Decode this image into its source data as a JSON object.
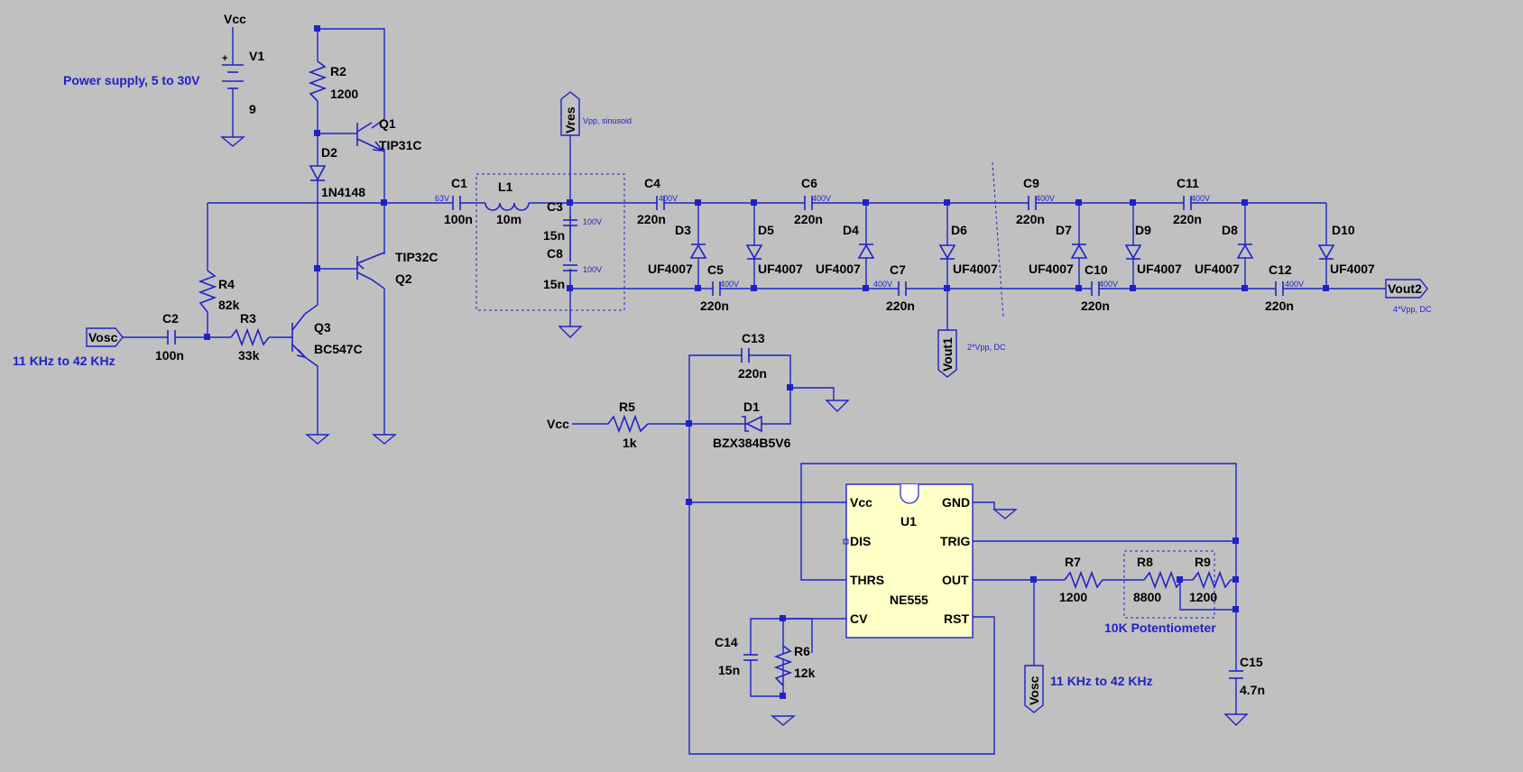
{
  "colors": {
    "background": "#c0c0c0",
    "wire": "#1e22c8",
    "chip": "#ffffc8"
  },
  "labels": {
    "vcc_top": "Vcc",
    "v1": "V1",
    "v1_val": "9",
    "v1_plus": "+",
    "power_note": "Power supply, 5 to 30V",
    "r2": "R2",
    "r2_val": "1200",
    "q1": "Q1",
    "q1_val": "TIP31C",
    "d2": "D2",
    "d2_val": "1N4148",
    "q2": "Q2",
    "q2_val": "TIP32C",
    "r4": "R4",
    "r4_val": "82k",
    "r3": "R3",
    "r3_val": "33k",
    "q3": "Q3",
    "q3_val": "BC547C",
    "c2": "C2",
    "c2_val": "100n",
    "vosc_in": "Vosc",
    "freq_left": "11 KHz to 42 KHz",
    "c1": "C1",
    "c1_val": "100n",
    "c1_rating": "63V",
    "l1": "L1",
    "l1_val": "10m",
    "c3": "C3",
    "c3_val": "15n",
    "c3_rating": "100V",
    "c8": "C8",
    "c8_val": "15n",
    "c8_rating": "100V",
    "vres": "Vres",
    "vres_note": "Vpp, sinusoid",
    "c4": "C4",
    "c4_val": "220n",
    "c4_rating": "400V",
    "c5": "C5",
    "c5_val": "220n",
    "c5_rating": "400V",
    "c6": "C6",
    "c6_val": "220n",
    "c6_rating": "400V",
    "c7": "C7",
    "c7_val": "220n",
    "c7_rating": "400V",
    "c9": "C9",
    "c9_val": "220n",
    "c9_rating": "400V",
    "c10": "C10",
    "c10_val": "220n",
    "c10_rating": "400V",
    "c11": "C11",
    "c11_val": "220n",
    "c11_rating": "400V",
    "c12": "C12",
    "c12_val": "220n",
    "c12_rating": "400V",
    "d3": "D3",
    "d4": "D4",
    "d5": "D5",
    "d6": "D6",
    "d7": "D7",
    "d8": "D8",
    "d9": "D9",
    "d10": "D10",
    "diode_val": "UF4007",
    "vout1": "Vout1",
    "vout1_note": "2*Vpp, DC",
    "vout2": "Vout2",
    "vout2_note": "4*Vpp, DC",
    "c13": "C13",
    "c13_val": "220n",
    "r5": "R5",
    "r5_val": "1k",
    "vcc_r5": "Vcc",
    "d1": "D1",
    "d1_val": "BZX384B5V6",
    "u1": "U1",
    "u1_val": "NE555",
    "pin_vcc": "Vcc",
    "pin_gnd": "GND",
    "pin_dis": "DIS",
    "pin_trig": "TRIG",
    "pin_thrs": "THRS",
    "pin_out": "OUT",
    "pin_cv": "CV",
    "pin_rst": "RST",
    "r7": "R7",
    "r7_val": "1200",
    "r8": "R8",
    "r8_val": "8800",
    "r9": "R9",
    "r9_val": "1200",
    "pot_note": "10K Potentiometer",
    "c14": "C14",
    "c14_val": "15n",
    "r6": "R6",
    "r6_val": "12k",
    "vosc_out": "Vosc",
    "freq_bottom": "11 KHz to 42 KHz",
    "c15": "C15",
    "c15_val": "4.7n"
  }
}
